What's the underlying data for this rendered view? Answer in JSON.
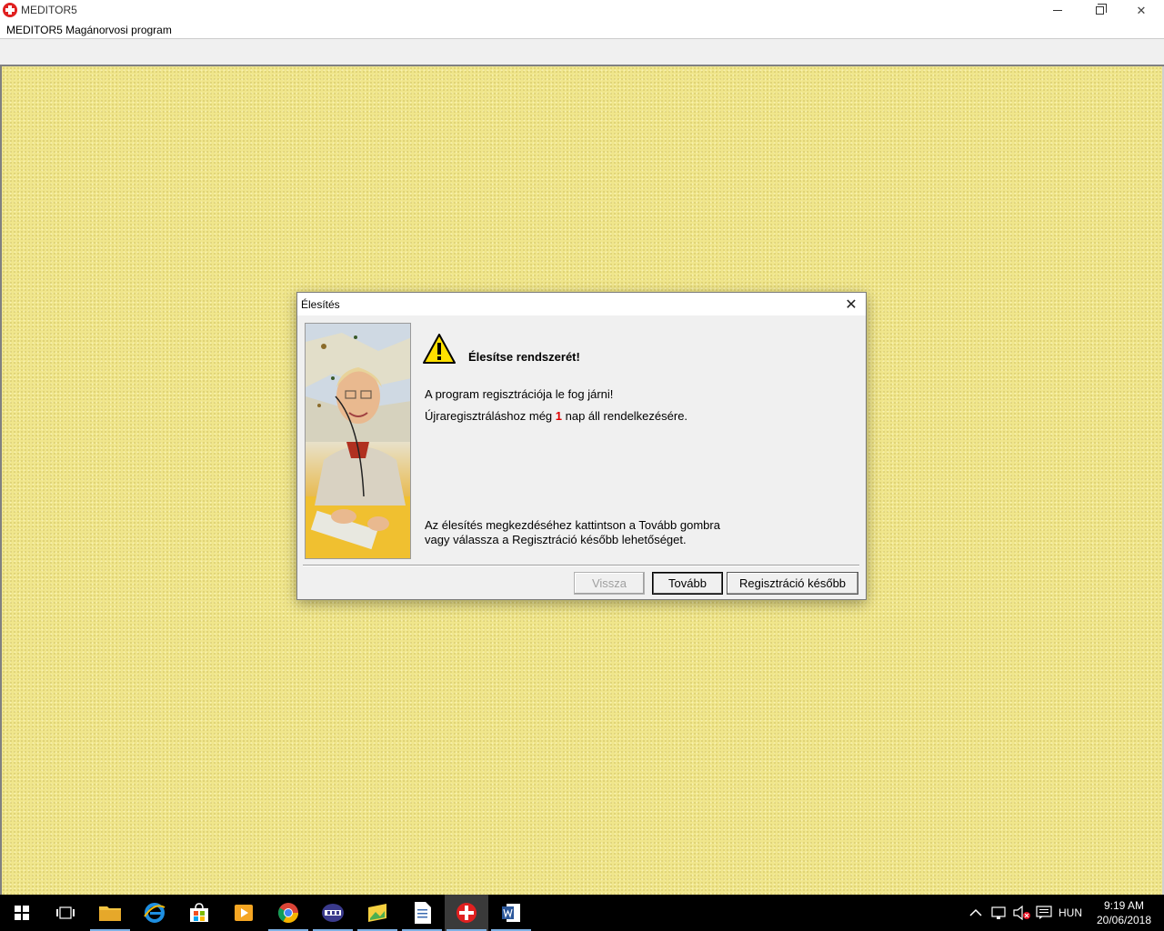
{
  "window": {
    "title": "MEDITOR5",
    "menu_title": "MEDITOR5 Magánorvosi program"
  },
  "dialog": {
    "title": "Élesítés",
    "heading": "Élesítse rendszerét!",
    "line1": "A program regisztrációja le fog járni!",
    "line2_prefix": "Újraregisztráláshoz még ",
    "days_left": "1",
    "line2_suffix": " nap áll rendelkezésére.",
    "instruction_line1": "Az élesítés megkezdéséhez kattintson a Tovább gombra",
    "instruction_line2": "vagy válassza a Regisztráció később lehetőséget.",
    "buttons": {
      "back": "Vissza",
      "next": "Tovább",
      "later": "Regisztráció később"
    }
  },
  "taskbar": {
    "language": "HUN",
    "time": "9:19 AM",
    "date": "20/06/2018"
  },
  "colors": {
    "workspace": "#f0e68c",
    "days_highlight": "#e00000",
    "taskbar": "#000000"
  }
}
